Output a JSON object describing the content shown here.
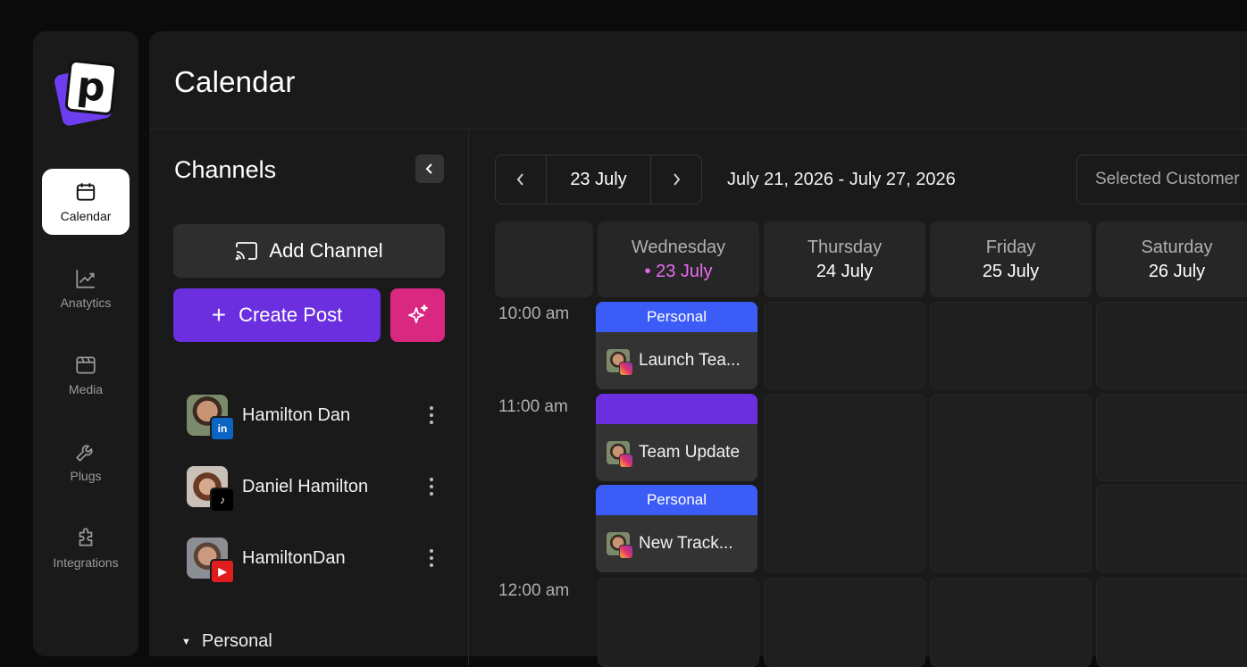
{
  "nav": {
    "items": [
      {
        "label": "Calendar",
        "icon": "calendar-icon",
        "active": true
      },
      {
        "label": "Anatytics",
        "icon": "chart-line-icon",
        "active": false
      },
      {
        "label": "Media",
        "icon": "media-icon",
        "active": false
      },
      {
        "label": "Plugs",
        "icon": "wrench-icon",
        "active": false
      },
      {
        "label": "Integrations",
        "icon": "puzzle-icon",
        "active": false
      }
    ]
  },
  "header": {
    "title": "Calendar"
  },
  "channels": {
    "title": "Channels",
    "add_channel_label": "Add Channel",
    "create_post_label": "Create Post",
    "items": [
      {
        "name": "Hamilton Dan",
        "platform": "linkedin"
      },
      {
        "name": "Daniel Hamilton",
        "platform": "tiktok"
      },
      {
        "name": "HamiltonDan",
        "platform": "youtube"
      }
    ],
    "group_label": "Personal"
  },
  "toolbar": {
    "current_date": "23 July",
    "range": "July 21, 2026 - July 27, 2026",
    "customer_placeholder": "Selected Customer"
  },
  "calendar": {
    "days": [
      {
        "name": "Wednesday",
        "date": "23 July",
        "today": true
      },
      {
        "name": "Thursday",
        "date": "24 July",
        "today": false
      },
      {
        "name": "Friday",
        "date": "25 July",
        "today": false
      },
      {
        "name": "Saturday",
        "date": "26 July",
        "today": false
      }
    ],
    "today_dot": "•",
    "times": [
      "10:00 am",
      "11:00 am",
      "12:00 am"
    ],
    "posts": [
      {
        "tag": "Personal",
        "tag_color": "#3b5cf6",
        "title": "Launch Tea...",
        "platform": "instagram"
      },
      {
        "tag": "",
        "tag_color": "#6b2fe0",
        "title": "Team Update",
        "platform": "instagram"
      },
      {
        "tag": "Personal",
        "tag_color": "#3b5cf6",
        "title": "New Track...",
        "platform": "instagram"
      }
    ]
  },
  "colors": {
    "accent_purple": "#6b2fe0",
    "accent_pink": "#d9287f",
    "today_pink": "#e86bf0",
    "tag_blue": "#3b5cf6"
  }
}
